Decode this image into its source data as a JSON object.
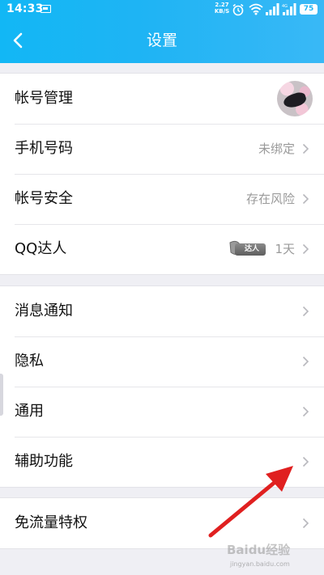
{
  "status_bar": {
    "time": "14:33",
    "speed_value": "2.27",
    "speed_unit": "KB/S",
    "battery": "75"
  },
  "header": {
    "title": "设置",
    "back_icon": "chevron-left-icon"
  },
  "groups": [
    {
      "rows": [
        {
          "label": "帐号管理",
          "value": "",
          "accessory": "avatar"
        },
        {
          "label": "手机号码",
          "value": "未绑定",
          "accessory": "chevron"
        },
        {
          "label": "帐号安全",
          "value": "存在风险",
          "accessory": "chevron"
        },
        {
          "label": "QQ达人",
          "value": "1天",
          "badge": "达人",
          "accessory": "chevron"
        }
      ]
    },
    {
      "rows": [
        {
          "label": "消息通知",
          "value": "",
          "accessory": "chevron"
        },
        {
          "label": "隐私",
          "value": "",
          "accessory": "chevron"
        },
        {
          "label": "通用",
          "value": "",
          "accessory": "chevron"
        },
        {
          "label": "辅助功能",
          "value": "",
          "accessory": "chevron"
        }
      ]
    },
    {
      "rows": [
        {
          "label": "免流量特权",
          "value": "",
          "accessory": "chevron"
        }
      ]
    }
  ],
  "watermark": {
    "logo": "Baidu经验",
    "sub": "jingyan.baidu.com"
  },
  "colors": {
    "header_gradient_start": "#12b7f5",
    "header_gradient_end": "#39b8f6",
    "page_background": "#efeff4",
    "label_text": "#111111",
    "value_text": "#9a9a9a",
    "annotation_arrow": "#e02020"
  }
}
